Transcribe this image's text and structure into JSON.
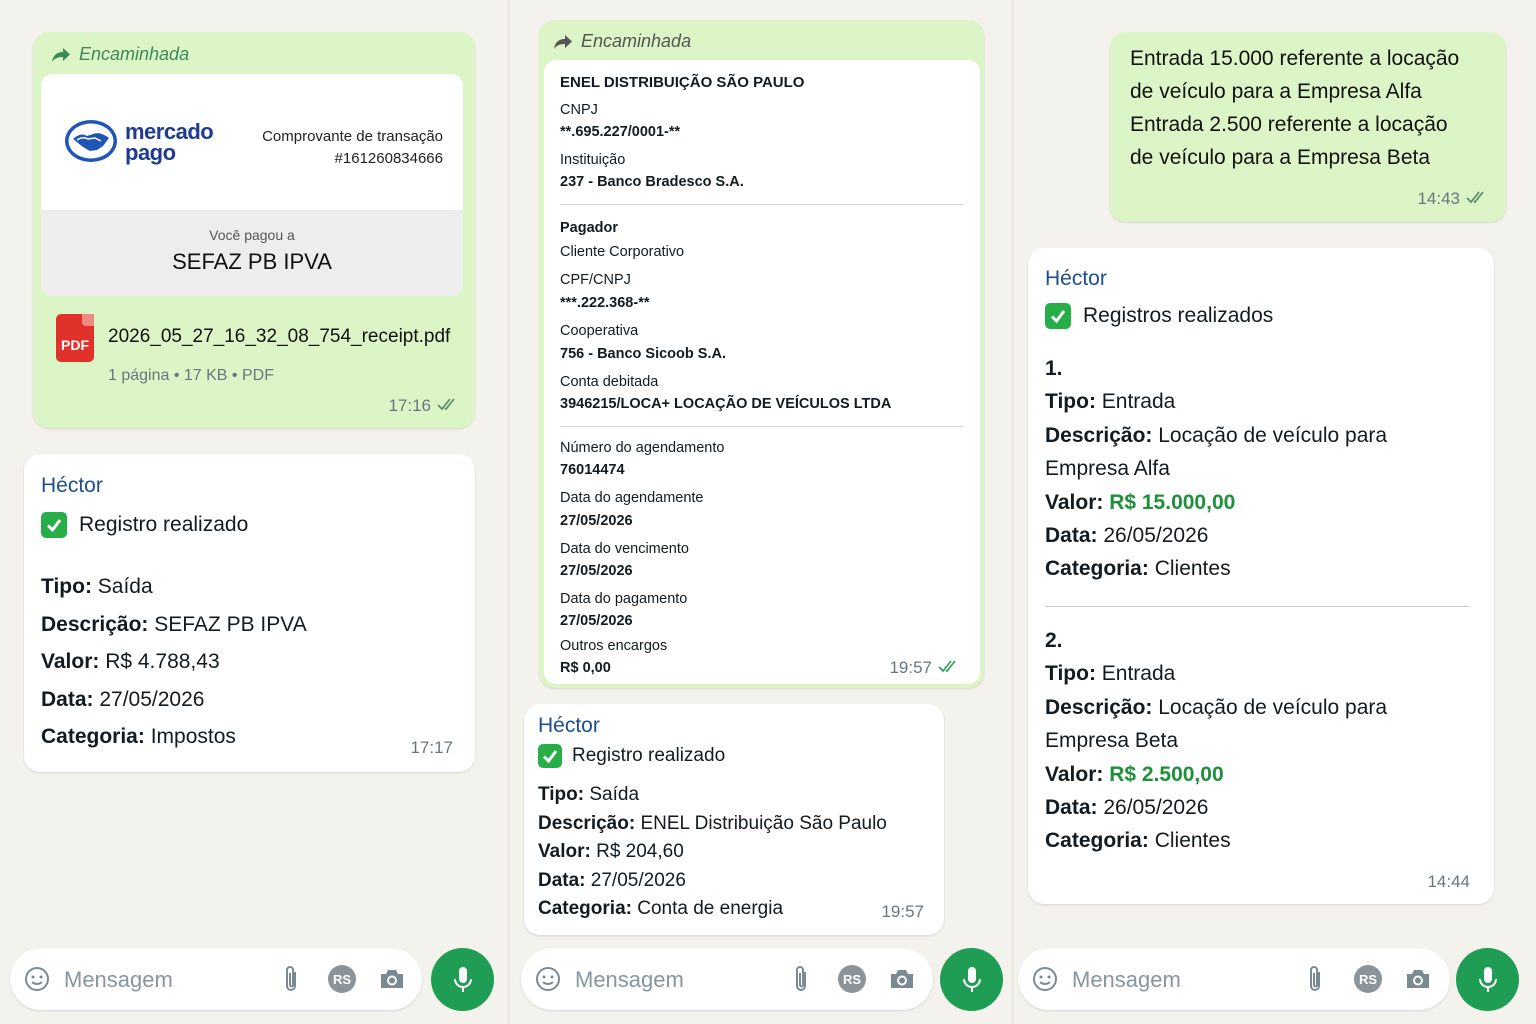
{
  "common": {
    "forwarded_label": "Encaminhada",
    "composer_placeholder": "Mensagem",
    "currency_badge": "RS"
  },
  "panel1": {
    "receipt": {
      "brand_line1": "mercado",
      "brand_line2": "pago",
      "title": "Comprovante de transação",
      "transaction_id": "#161260834666",
      "paid_to_label": "Você pagou a",
      "payee": "SEFAZ PB IPVA",
      "file_badge": "PDF",
      "file_name": "2026_05_27_16_32_08_754_receipt.pdf",
      "file_meta": "1 página • 17 KB • PDF",
      "time": "17:16"
    },
    "reply": {
      "sender": "Héctor",
      "status": "Registro realizado",
      "tipo_label": "Tipo:",
      "tipo": "Saída",
      "desc_label": "Descrição:",
      "desc": "SEFAZ PB IPVA",
      "valor_label": "Valor:",
      "valor": "R$ 4.788,43",
      "data_label": "Data:",
      "data": "27/05/2026",
      "cat_label": "Categoria:",
      "cat": "Impostos",
      "time": "17:17"
    }
  },
  "panel2": {
    "receipt": {
      "company": "ENEL DISTRIBUIÇÃO SÃO PAULO",
      "cnpj_label": "CNPJ",
      "cnpj": "**.695.227/0001-**",
      "inst_label": "Instituição",
      "inst": "237 - Banco Bradesco S.A.",
      "pagador_label": "Pagador",
      "pagador": "Cliente Corporativo",
      "cpf_label": "CPF/CNPJ",
      "cpf": "***.222.368-**",
      "coop_label": "Cooperativa",
      "coop": "756 - Banco Sicoob S.A.",
      "conta_label": "Conta debitada",
      "conta": "3946215/LOCA+ LOCAÇÃO DE VEÍCULOS LTDA",
      "num_label": "Número do agendamento",
      "num": "76014474",
      "dag_label": "Data do agendamente",
      "dag": "27/05/2026",
      "dven_label": "Data do vencimento",
      "dven": "27/05/2026",
      "dpag_label": "Data do pagamento",
      "dpag": "27/05/2026",
      "outros_label": "Outros encargos",
      "outros": "R$ 0,00",
      "time": "19:57"
    },
    "reply": {
      "sender": "Héctor",
      "status": "Registro realizado",
      "tipo_label": "Tipo:",
      "tipo": "Saída",
      "desc_label": "Descrição:",
      "desc": "ENEL Distribuição São Paulo",
      "valor_label": "Valor:",
      "valor": "R$ 204,60",
      "data_label": "Data:",
      "data": "27/05/2026",
      "cat_label": "Categoria:",
      "cat": "Conta de energia",
      "time": "19:57"
    }
  },
  "panel3": {
    "outgoing": {
      "line1": "Entrada 15.000 referente a locação",
      "line2": "de veículo para a Empresa Alfa",
      "line3": "Entrada 2.500 referente a locação",
      "line4": "de veículo para a Empresa Beta",
      "time": "14:43"
    },
    "reply": {
      "sender": "Héctor",
      "status": "Registros realizados",
      "items": [
        {
          "num": "1.",
          "tipo_label": "Tipo:",
          "tipo": "Entrada",
          "desc_label": "Descrição:",
          "desc1": "Locação de veículo para",
          "desc2": "Empresa Alfa",
          "valor_label": "Valor:",
          "valor": "R$ 15.000,00",
          "data_label": "Data:",
          "data": "26/05/2026",
          "cat_label": "Categoria:",
          "cat": "Clientes"
        },
        {
          "num": "2.",
          "tipo_label": "Tipo:",
          "tipo": "Entrada",
          "desc_label": "Descrição:",
          "desc1": "Locação de veículo para",
          "desc2": "Empresa Beta",
          "valor_label": "Valor:",
          "valor": "R$ 2.500,00",
          "data_label": "Data:",
          "data": "26/05/2026",
          "cat_label": "Categoria:",
          "cat": "Clientes"
        }
      ],
      "time": "14:44"
    }
  },
  "colors": {
    "outgoing_bubble": "#dcf5c7",
    "sender_name": "#1c4f8c",
    "value_green": "#1f8f3a",
    "mic_button": "#1f9d55",
    "check_green": "#27ae48"
  },
  "icons": [
    "forward-icon",
    "double-check-icon",
    "mercado-pago-logo",
    "pdf-icon",
    "check-mark-icon",
    "emoji-icon",
    "attach-icon",
    "currency-icon",
    "camera-icon",
    "microphone-icon"
  ]
}
